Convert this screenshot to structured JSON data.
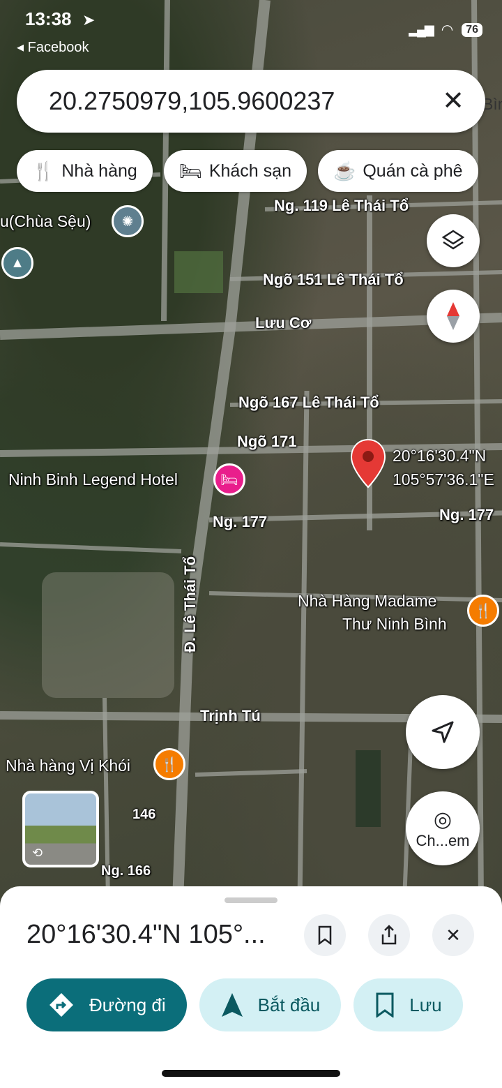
{
  "status": {
    "time": "13:38",
    "back_app": "Facebook",
    "battery": "76"
  },
  "search": {
    "query": "20.2750979,105.9600237"
  },
  "chips": [
    {
      "label": "Nhà hàng",
      "icon": "fork-knife-icon"
    },
    {
      "label": "Khách sạn",
      "icon": "bed-icon"
    },
    {
      "label": "Quán cà phê",
      "icon": "coffee-cup-icon"
    }
  ],
  "map_labels": {
    "ng119": "Ng. 119 Lê Thái Tổ",
    "chua": "u(Chùa Sệu)",
    "ngo151": "Ngõ 151 Lê Thái Tổ",
    "luuco": "Lưu Cơ",
    "ngo167": "Ngõ 167 Lê Thái Tổ",
    "ngo171": "Ngõ 171",
    "hotel": "Ninh Binh Legend Hotel",
    "ng177a": "Ng. 177",
    "ng177b": "Ng. 177",
    "pin_lat": "20°16'30.4\"N",
    "pin_lng": "105°57'36.1\"E",
    "madame1": "Nhà Hàng Madame",
    "madame2": "Thư Ninh Bình",
    "lethaito": "Đ. Lê Thái Tổ",
    "trinhtu": "Trịnh Tú",
    "vikhoi": "Nhà hàng Vị Khói",
    "n146": "146",
    "ng166": "Ng. 166",
    "edge_bin": "Bìn"
  },
  "street_view_label": "Ch...em",
  "sheet": {
    "title": "20°16'30.4\"N 105°...",
    "actions": [
      {
        "label": "Đường đi",
        "icon": "directions-icon"
      },
      {
        "label": "Bắt đầu",
        "icon": "navigation-arrow-icon"
      },
      {
        "label": "Lưu",
        "icon": "bookmark-icon"
      }
    ]
  },
  "colors": {
    "primary": "#0b6e7a",
    "secondary_bg": "#d3f0f4",
    "pin": "#e53935",
    "poi_orange": "#f57c00",
    "poi_pink": "#e91e8c"
  }
}
